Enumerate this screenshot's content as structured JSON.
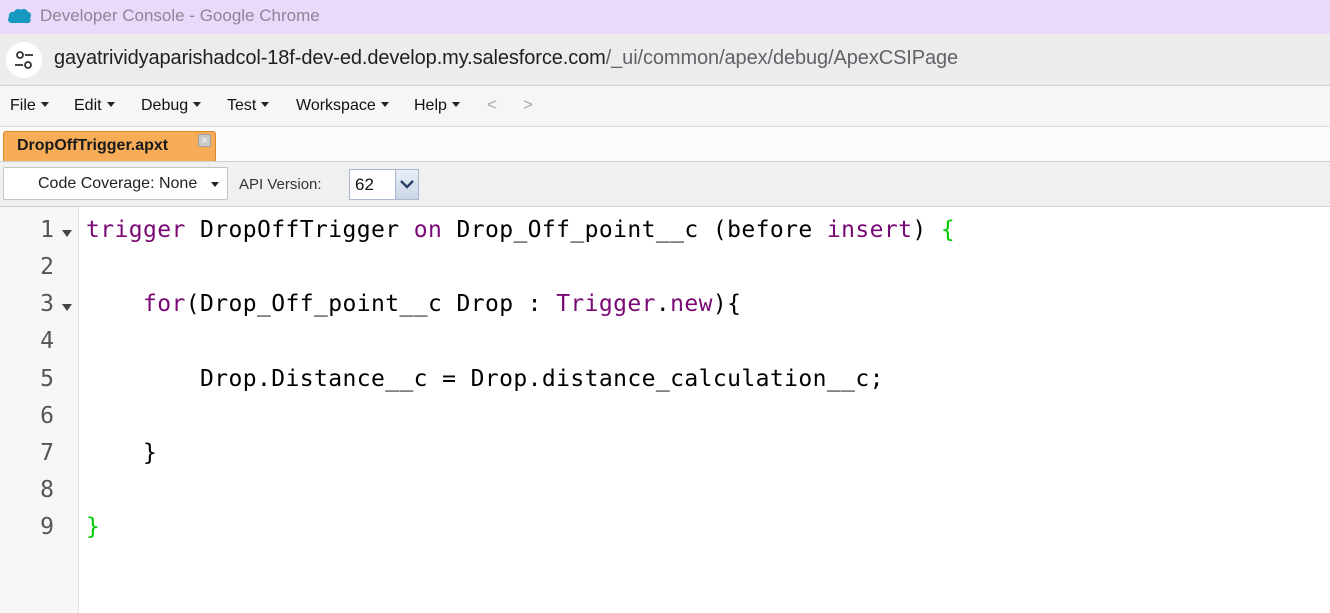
{
  "window": {
    "title": "Developer Console - Google Chrome",
    "logo_icon": "salesforce-cloud-icon"
  },
  "urlbar": {
    "host": "gayatrividyaparishadcol-18f-dev-ed.develop.my.salesforce.com",
    "path": "/_ui/common/apex/debug/ApexCSIPage"
  },
  "menu": {
    "items": [
      "File",
      "Edit",
      "Debug",
      "Test",
      "Workspace",
      "Help"
    ],
    "back": "<",
    "forward": ">"
  },
  "tabs": [
    {
      "label": "DropOffTrigger.apxt",
      "active": true
    }
  ],
  "toolbar": {
    "coverage": "Code Coverage: None",
    "api_label": "API Version:",
    "api_value": "62"
  },
  "editor": {
    "line_numbers": [
      "1",
      "2",
      "3",
      "4",
      "5",
      "6",
      "7",
      "8",
      "9"
    ],
    "lines": [
      {
        "t1": "trigger",
        "t2": " DropOffTrigger ",
        "t3": "on",
        "t4": " Drop_Off_point__c (before ",
        "t5": "insert",
        "t6": ") ",
        "t7": "{"
      },
      {
        "t1": ""
      },
      {
        "t1": "    ",
        "t2": "for",
        "t3": "(Drop_Off_point__c Drop : ",
        "t4": "Trigger",
        "t5": ".",
        "t6": "new",
        "t7": "){"
      },
      {
        "t1": ""
      },
      {
        "t1": "        Drop.Distance__c = Drop.distance_calculation__c;"
      },
      {
        "t1": ""
      },
      {
        "t1": "    }"
      },
      {
        "t1": ""
      },
      {
        "t1": "}"
      }
    ]
  },
  "colors": {
    "keyword": "#7a0874",
    "brace": "#00cc00",
    "tab_active": "#f7ad57",
    "title_bar": "#e9dafb"
  }
}
